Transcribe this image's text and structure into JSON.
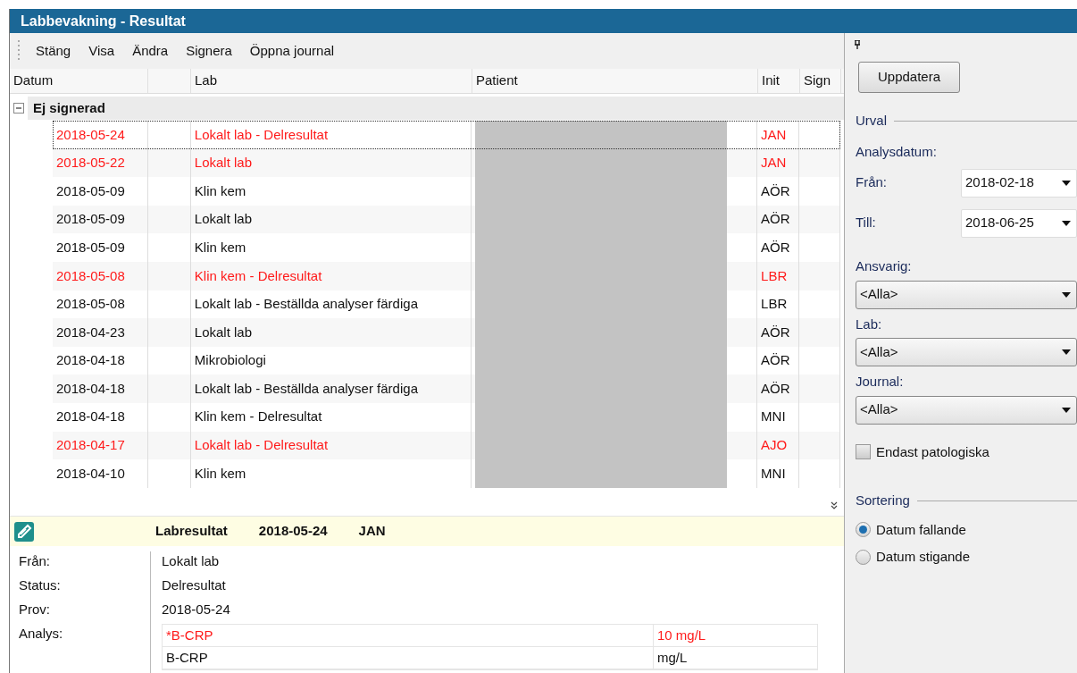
{
  "window": {
    "title": "Labbevakning - Resultat"
  },
  "menu": [
    "Stäng",
    "Visa",
    "Ändra",
    "Signera",
    "Öppna journal"
  ],
  "table": {
    "columns": [
      "Datum",
      "",
      "Lab",
      "Patient",
      "Init",
      "Sign"
    ],
    "group": {
      "label": "Ej signerad",
      "expanded": true
    },
    "rows": [
      {
        "date": "2018-05-24",
        "lab": "Lokalt lab - Delresultat",
        "init": "JAN",
        "abnormal": true,
        "selected": true
      },
      {
        "date": "2018-05-22",
        "lab": "Lokalt lab",
        "init": "JAN",
        "abnormal": true,
        "selected": false
      },
      {
        "date": "2018-05-09",
        "lab": "Klin kem",
        "init": "AÖR",
        "abnormal": false,
        "selected": false
      },
      {
        "date": "2018-05-09",
        "lab": "Lokalt lab",
        "init": "AÖR",
        "abnormal": false,
        "selected": false
      },
      {
        "date": "2018-05-09",
        "lab": "Klin kem",
        "init": "AÖR",
        "abnormal": false,
        "selected": false
      },
      {
        "date": "2018-05-08",
        "lab": "Klin kem - Delresultat",
        "init": "LBR",
        "abnormal": true,
        "selected": false
      },
      {
        "date": "2018-05-08",
        "lab": "Lokalt lab - Beställda analyser färdiga",
        "init": "LBR",
        "abnormal": false,
        "selected": false
      },
      {
        "date": "2018-04-23",
        "lab": "Lokalt lab",
        "init": "AÖR",
        "abnormal": false,
        "selected": false
      },
      {
        "date": "2018-04-18",
        "lab": "Mikrobiologi",
        "init": "AÖR",
        "abnormal": false,
        "selected": false
      },
      {
        "date": "2018-04-18",
        "lab": "Lokalt lab - Beställda analyser färdiga",
        "init": "AÖR",
        "abnormal": false,
        "selected": false
      },
      {
        "date": "2018-04-18",
        "lab": "Klin kem - Delresultat",
        "init": "MNI",
        "abnormal": false,
        "selected": false
      },
      {
        "date": "2018-04-17",
        "lab": "Lokalt lab - Delresultat",
        "init": "AJO",
        "abnormal": true,
        "selected": false
      },
      {
        "date": "2018-04-10",
        "lab": "Klin kem",
        "init": "MNI",
        "abnormal": false,
        "selected": false
      }
    ]
  },
  "detail": {
    "header": [
      "Labresultat",
      "2018-05-24",
      "JAN"
    ],
    "fields": [
      {
        "label": "Från:",
        "value": "Lokalt lab"
      },
      {
        "label": "Status:",
        "value": "Delresultat"
      },
      {
        "label": "Prov:",
        "value": "2018-05-24"
      }
    ],
    "analys_label": "Analys:",
    "analyses": [
      {
        "name": "*B-CRP",
        "result": "10 mg/L",
        "abnormal": true
      },
      {
        "name": "B-CRP",
        "result": "mg/L",
        "abnormal": false
      }
    ]
  },
  "panel": {
    "update_button": "Uppdatera",
    "urval": "Urval",
    "analysdatum": "Analysdatum:",
    "date_from": {
      "label": "Från:",
      "value": "2018-02-18"
    },
    "date_to": {
      "label": "Till:",
      "value": "2018-06-25"
    },
    "filters": [
      {
        "label": "Ansvarig:",
        "value": "<Alla>"
      },
      {
        "label": "Lab:",
        "value": "<Alla>"
      },
      {
        "label": "Journal:",
        "value": "<Alla>"
      }
    ],
    "only_pathological": {
      "label": "Endast patologiska",
      "checked": false
    },
    "sorting": "Sortering",
    "sort_options": [
      {
        "label": "Datum fallande",
        "selected": true
      },
      {
        "label": "Datum stigande",
        "selected": false
      }
    ]
  }
}
